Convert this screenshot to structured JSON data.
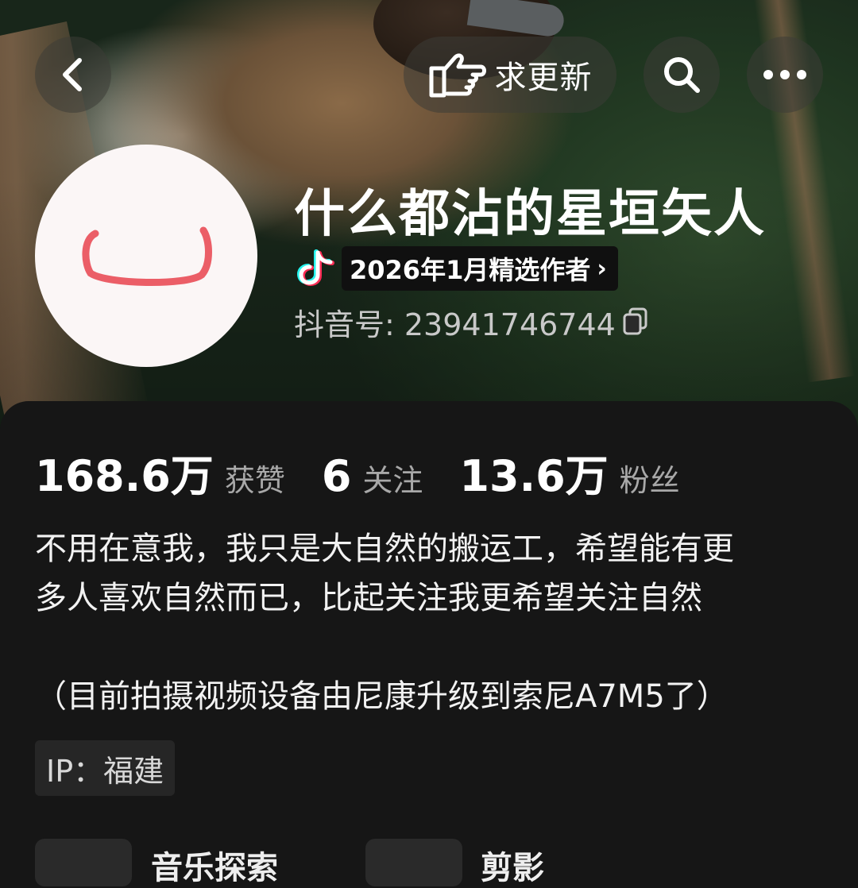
{
  "nav": {
    "back_icon": "chevron-left-icon",
    "update_label": "求更新",
    "update_icon": "pointing-hand-icon",
    "search_icon": "search-icon",
    "more_icon": "more-dots-icon"
  },
  "profile": {
    "nickname": "什么都沾的星垣矢人",
    "badge_text": "2026年1月精选作者",
    "badge_chevron": "›",
    "douyin_id_label": "抖音号: 23941746744",
    "copy_icon": "copy-icon"
  },
  "stats": [
    {
      "value": "168.6万",
      "label": "获赞"
    },
    {
      "value": "6",
      "label": "关注"
    },
    {
      "value": "13.6万",
      "label": "粉丝"
    }
  ],
  "bio": {
    "line1": "不用在意我，我只是大自然的搬运工，希望能有更",
    "line2": "多人喜欢自然而已，比起关注我更希望关注自然",
    "line3": "（目前拍摄视频设备由尼康升级到索尼A7M5了）"
  },
  "ip_label": "IP：福建",
  "bottom": {
    "card_a_text": "音乐探索",
    "card_b_text": "剪影"
  },
  "colors": {
    "background": "#161616",
    "badge_bg": "#101010",
    "ip_bg": "#262626",
    "avatar_mark": "#e8434d",
    "douyin_cyan": "#25f4ee",
    "douyin_pink": "#fe2c55"
  }
}
